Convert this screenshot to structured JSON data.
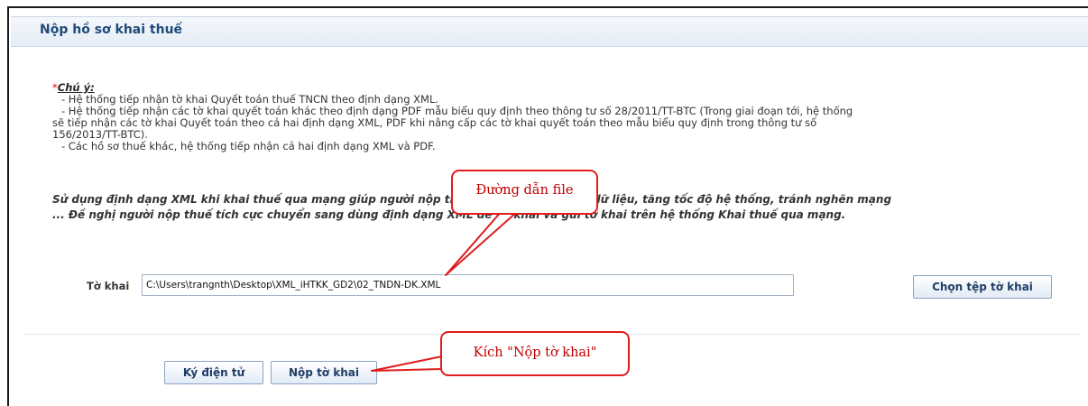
{
  "title": "Nộp hồ sơ khai thuế",
  "notes": {
    "star": "*",
    "heading": "Chú ý:",
    "lines": [
      "- Hệ thống tiếp nhận tờ khai Quyết toán thuế TNCN theo định dạng XML.",
      "- Hệ thống tiếp nhận các tờ khai quyết toán khác theo định dạng PDF mẫu biểu quy định theo thông tư số 28/2011/TT-BTC (Trong giai đoạn tới, hệ thống",
      "sẽ tiếp nhận các tờ khai Quyết toán theo cả hai định dạng XML, PDF khi nâng cấp các tờ khai quyết toán theo mẫu biểu quy định trong thông tư số",
      "156/2013/TT-BTC).",
      "- Các hồ sơ thuế khác, hệ thống tiếp nhận cả hai định dạng XML và PDF."
    ]
  },
  "emphasis": {
    "line1": "Sử dụng định dạng XML khi khai thuế qua mạng giúp người nộp thuế dễ dàng kiểm soát dữ liệu, tăng tốc độ hệ thống, tránh nghẽn mạng",
    "line2": "... Đề nghị người nộp thuế tích cực chuyển sang dùng định dạng XML để kê khai và gửi tờ khai trên hệ thống Khai thuế qua mạng."
  },
  "form": {
    "label": "Tờ khai",
    "file_path": "C:\\Users\\trangnth\\Desktop\\XML_iHTKK_GD2\\02_TNDN-DK.XML"
  },
  "buttons": {
    "choose": "Chọn tệp tờ khai",
    "sign": "Ký điện tử",
    "submit": "Nộp tờ khai"
  },
  "callouts": {
    "file_path": "Đường dẫn file",
    "submit": "Kích \"Nộp tờ khai\""
  },
  "colors": {
    "title": "#1f4a7a",
    "callout_border": "#e01c1c",
    "callout_text": "#c00000"
  }
}
